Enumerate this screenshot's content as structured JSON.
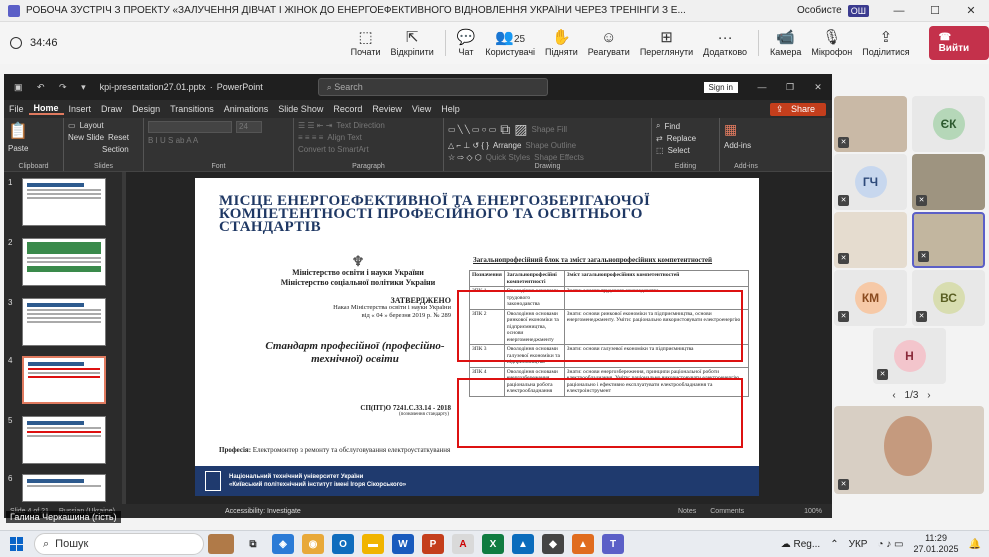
{
  "window": {
    "title": "РОБОЧА ЗУСТРІЧ З ПРОЕКТУ «ЗАЛУЧЕННЯ ДІВЧАТ І ЖІНОК ДО ЕНЕРГОЕФЕКТИВНОГО ВІДНОВЛЕННЯ УКРАЇНИ ЧЕРЕЗ ТРЕНІНГИ З Е...",
    "account_label": "Особисте",
    "account_badge": "ОШ",
    "minimize": "—",
    "maximize": "☐",
    "close": "✕"
  },
  "meeting_bar": {
    "timer": "34:46",
    "buttons": [
      {
        "label": "Почати",
        "icon": "⬚"
      },
      {
        "label": "Відкріпити",
        "icon": "⇱"
      },
      {
        "label": "Чат",
        "icon": "💬"
      },
      {
        "label": "Користувачі",
        "icon": "👥",
        "count": "25"
      },
      {
        "label": "Підняти",
        "icon": "✋"
      },
      {
        "label": "Реагувати",
        "icon": "☺"
      },
      {
        "label": "Переглянути",
        "icon": "⊞"
      },
      {
        "label": "Додатково",
        "icon": "···"
      },
      {
        "label": "Камера",
        "icon": "📹"
      },
      {
        "label": "Мікрофон",
        "icon": "🎙"
      },
      {
        "label": "Поділитися",
        "icon": "⇪"
      }
    ],
    "leave_label": "Вийти"
  },
  "powerpoint": {
    "filename": "kpi-presentation27.01.pptx",
    "app": "PowerPoint",
    "search_placeholder": "Search",
    "sign_in": "Sign in",
    "tabs": [
      "File",
      "Home",
      "Insert",
      "Draw",
      "Design",
      "Transitions",
      "Animations",
      "Slide Show",
      "Record",
      "Review",
      "View",
      "Help"
    ],
    "active_tab": "Home",
    "share": "Share",
    "ribbon": {
      "clipboard": "Clipboard",
      "paste": "Paste",
      "slides": "Slides",
      "new_slide": "New Slide",
      "layout": "Layout",
      "reset": "Reset",
      "section": "Section",
      "font": "Font",
      "font_size": "24",
      "paragraph": "Paragraph",
      "text_direction": "Text Direction",
      "align_text": "Align Text",
      "convert_smartart": "Convert to SmartArt",
      "drawing": "Drawing",
      "arrange": "Arrange",
      "quick_styles": "Quick Styles",
      "shape_fill": "Shape Fill",
      "shape_outline": "Shape Outline",
      "shape_effects": "Shape Effects",
      "editing": "Editing",
      "find": "Find",
      "replace": "Replace",
      "select": "Select",
      "addins_group": "Add-ins",
      "addins": "Add-ins"
    },
    "thumbnails": [
      "1",
      "2",
      "3",
      "4",
      "5",
      "6"
    ],
    "selected_thumbnail": 4,
    "status": {
      "slide": "Slide 4 of 21",
      "language": "Russian (Ukraine)",
      "accessibility": "Accessibility: Investigate",
      "notes": "Notes",
      "comments": "Comments",
      "zoom": "100%"
    }
  },
  "slide": {
    "title": "МІСЦЕ ЕНЕРГОЕФЕКТИВНОЇ ТА ЕНЕРГОЗБЕРІГАЮЧОЇ КОМПЕТЕНТНОСТІ ПРОФЕСІЙНОГО ТА ОСВІТНЬОГО СТАНДАРТІВ",
    "ministry_1": "Міністерство освіти і науки України",
    "ministry_2": "Міністерство соціальної політики України",
    "approved": "ЗАТВЕРДЖЕНО",
    "order_1": "Наказ Міністерства освіти і науки України",
    "order_2": "від « 04 » березня 2019 р. № 289",
    "standard": "Стандарт професійної (професійно-технічної) освіти",
    "code": "СП(ПТ)О 7241.С.33.14 - 2018",
    "code_sub": "(позначення стандарту)",
    "profession_label": "Професія:",
    "profession_value": "Електромонтер з ремонту та обслуговування електроустаткування",
    "footer_1": "Національний технічний університет України",
    "footer_2": "«Київський політехнічний інститут імені Ігоря Сікорського»",
    "table_title": "Загальнопрофесійний блок та зміст загальнопрофесійних компетентностей",
    "table_headers": [
      "Позначення",
      "Загальнопрофесійні компетентності",
      "Зміст загальнопрофесійних компетентностей"
    ],
    "table_rows": [
      [
        "ЗПК 1",
        "Оволодіння основами трудового законодавства",
        "Знати: основи трудового законодавства"
      ],
      [
        "ЗПК 2",
        "Оволодіння основами ринкової економіки та підприємництва, основи енергоменеджменту",
        "Знати: основи ринкової економіки та підприємництва, основи енергоменеджменту. Уміти: раціонально використовувати електроенергію"
      ],
      [
        "ЗПК 3",
        "Оволодіння основами галузевої економіки та підприємництва",
        "Знати: основи галузевої економіки та підприємництва"
      ],
      [
        "ЗПК 4",
        "Оволодіння основами енергозбереження, раціональна робота електрообладнання",
        "Знати: основи енергозбереження, принципи раціональної роботи електрообладнання. Уміти: раціонально використовувати електроенергію, раціонально і ефективно експлуатувати електрообладнання та електроінструмент"
      ]
    ]
  },
  "participant_name": "Галина Черкашина (гість)",
  "gallery": [
    {
      "initials": "",
      "video": true
    },
    {
      "initials": "ЄК",
      "color": "#b5d7b8",
      "video": false
    },
    {
      "initials": "ГЧ",
      "color": "#c7d7ee",
      "video": false
    },
    {
      "initials": "",
      "video": true
    },
    {
      "initials": "",
      "video": true
    },
    {
      "initials": "",
      "video": true
    },
    {
      "initials": "КМ",
      "color": "#f6c9a7",
      "video": false
    },
    {
      "initials": "ВС",
      "color": "#d8ddb0",
      "video": false
    },
    {
      "initials": "Н",
      "color": "#f3c5cc",
      "video": false
    }
  ],
  "pager": "1/3",
  "taskbar": {
    "search_placeholder": "Пошук",
    "weather": "Reg...",
    "language": "УКР",
    "time": "11:29",
    "date": "27.01.2025"
  }
}
